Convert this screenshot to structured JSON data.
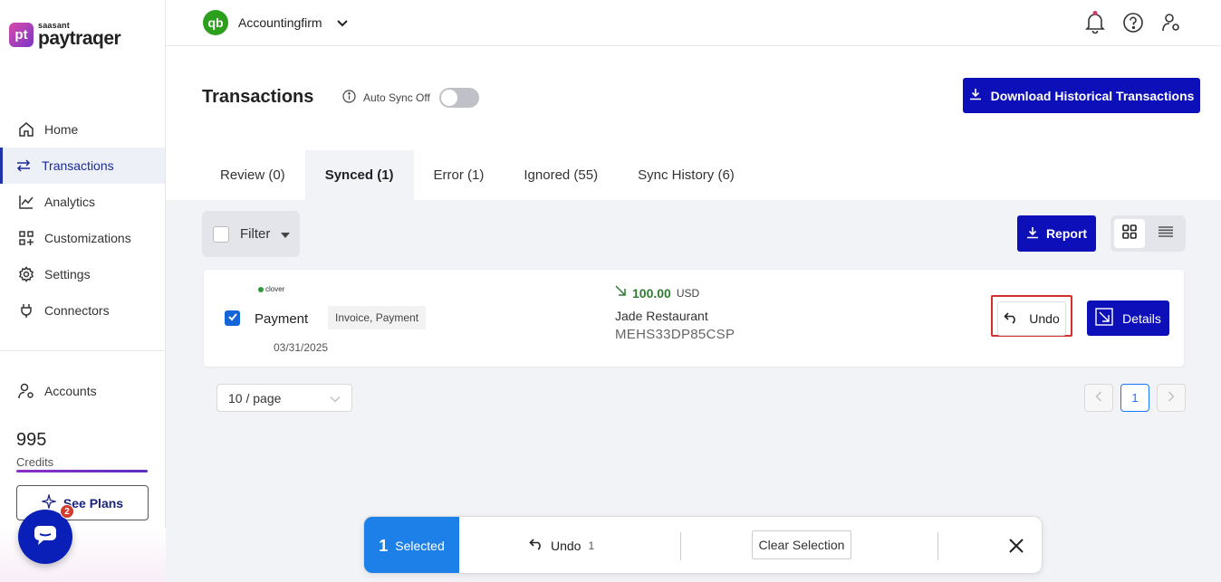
{
  "brand": {
    "logo_mark": "pt",
    "logo_small": "saasant",
    "logo_big": "paytraqer"
  },
  "nav": [
    {
      "label": "Home",
      "icon": "home-icon"
    },
    {
      "label": "Transactions",
      "icon": "transfer-icon"
    },
    {
      "label": "Analytics",
      "icon": "chart-icon"
    },
    {
      "label": "Customizations",
      "icon": "grid-icon"
    },
    {
      "label": "Settings",
      "icon": "gear-icon"
    },
    {
      "label": "Connectors",
      "icon": "plug-icon"
    }
  ],
  "accounts": {
    "label": "Accounts"
  },
  "credits": {
    "value": "995",
    "label": "Credits"
  },
  "see_plans": "See Plans",
  "chat": {
    "badge": "2"
  },
  "topbar": {
    "qb_logo": "qb",
    "company": "Accountingfirm"
  },
  "header": {
    "title": "Transactions",
    "autosync_label": "Auto Sync Off",
    "download_label": "Download Historical Transactions"
  },
  "tabs": [
    {
      "label": "Review (0)"
    },
    {
      "label": "Synced (1)"
    },
    {
      "label": "Error (1)"
    },
    {
      "label": "Ignored (55)"
    },
    {
      "label": "Sync History (6)"
    }
  ],
  "toolbar": {
    "filter_label": "Filter",
    "report_label": "Report"
  },
  "transaction": {
    "source": "clover",
    "type": "Payment",
    "tag": "Invoice, Payment",
    "date": "03/31/2025",
    "amount": "100.00",
    "currency": "USD",
    "customer": "Jade Restaurant",
    "id": "MEHS33DP85CSP",
    "undo_label": "Undo",
    "details_label": "Details"
  },
  "pagination": {
    "page_size": "10 / page",
    "current": "1",
    "prev": "<",
    "next": ">"
  },
  "selection_bar": {
    "count": "1",
    "selected_label": "Selected",
    "undo_label": "Undo",
    "undo_count": "1",
    "clear_label": "Clear Selection"
  },
  "colors": {
    "primary": "#0d0fb8",
    "accent_blue": "#1d7fe8",
    "success": "#2e7d32",
    "danger": "#d32f2f",
    "qb_green": "#2ca01c"
  }
}
